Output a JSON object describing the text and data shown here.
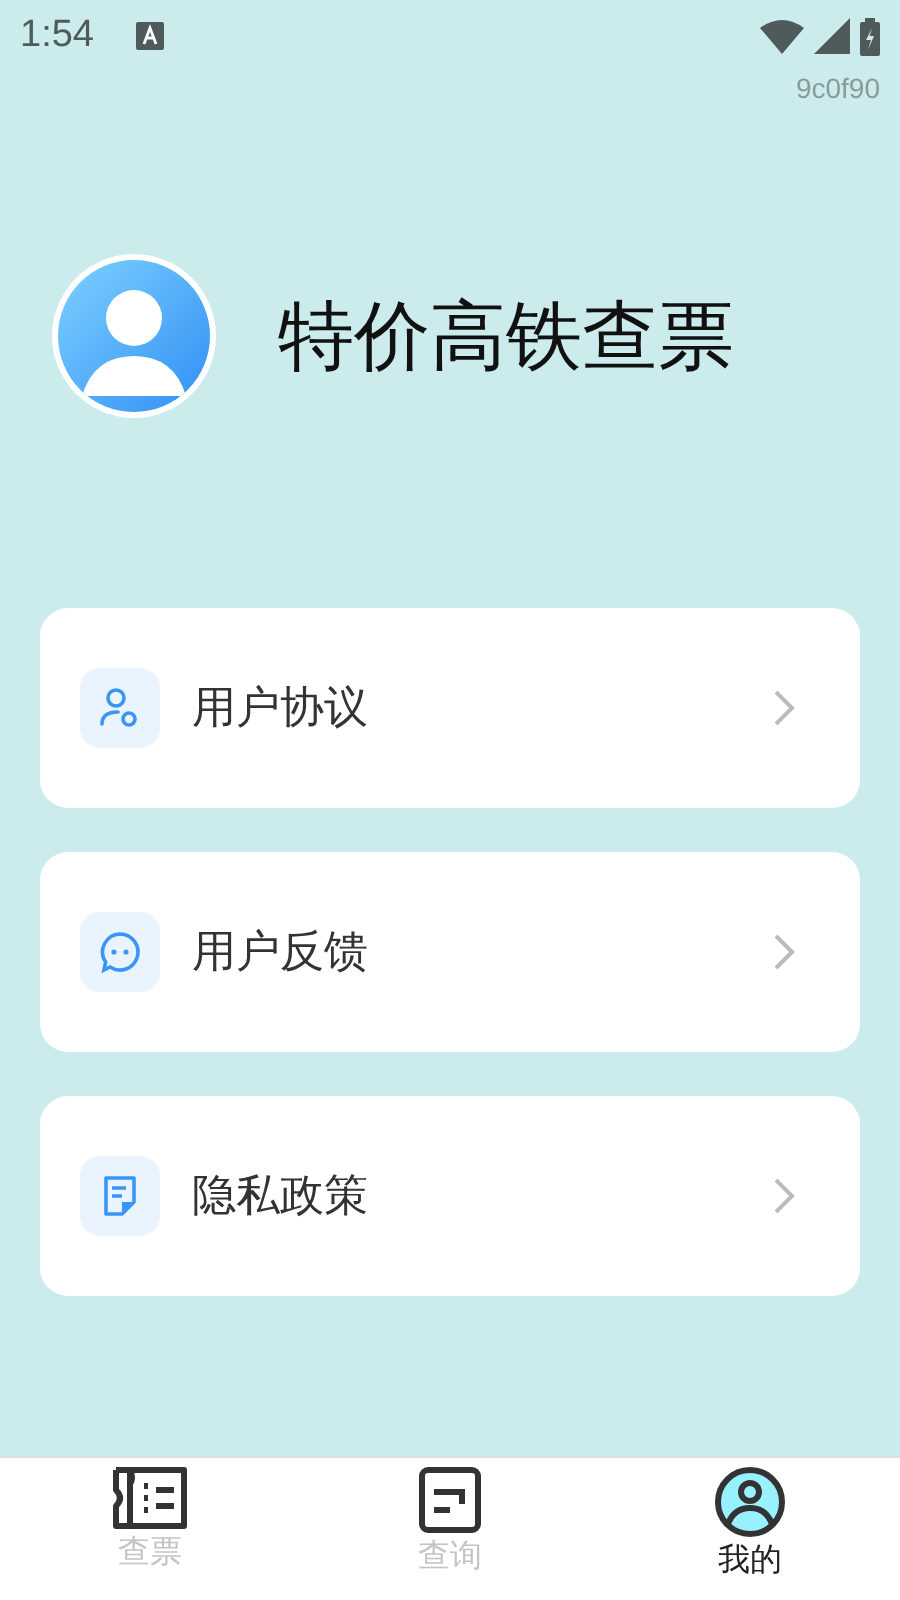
{
  "status_bar": {
    "time": "1:54"
  },
  "build_tag": "9c0f90",
  "profile": {
    "title": "特价高铁查票"
  },
  "menu": [
    {
      "label": "用户协议",
      "kind": "user"
    },
    {
      "label": "用户反馈",
      "kind": "chat"
    },
    {
      "label": "隐私政策",
      "kind": "doc"
    }
  ],
  "tabs": [
    {
      "label": "查票",
      "kind": "ticket",
      "selected": false
    },
    {
      "label": "查询",
      "kind": "query",
      "selected": false
    },
    {
      "label": "我的",
      "kind": "me",
      "selected": true
    }
  ]
}
